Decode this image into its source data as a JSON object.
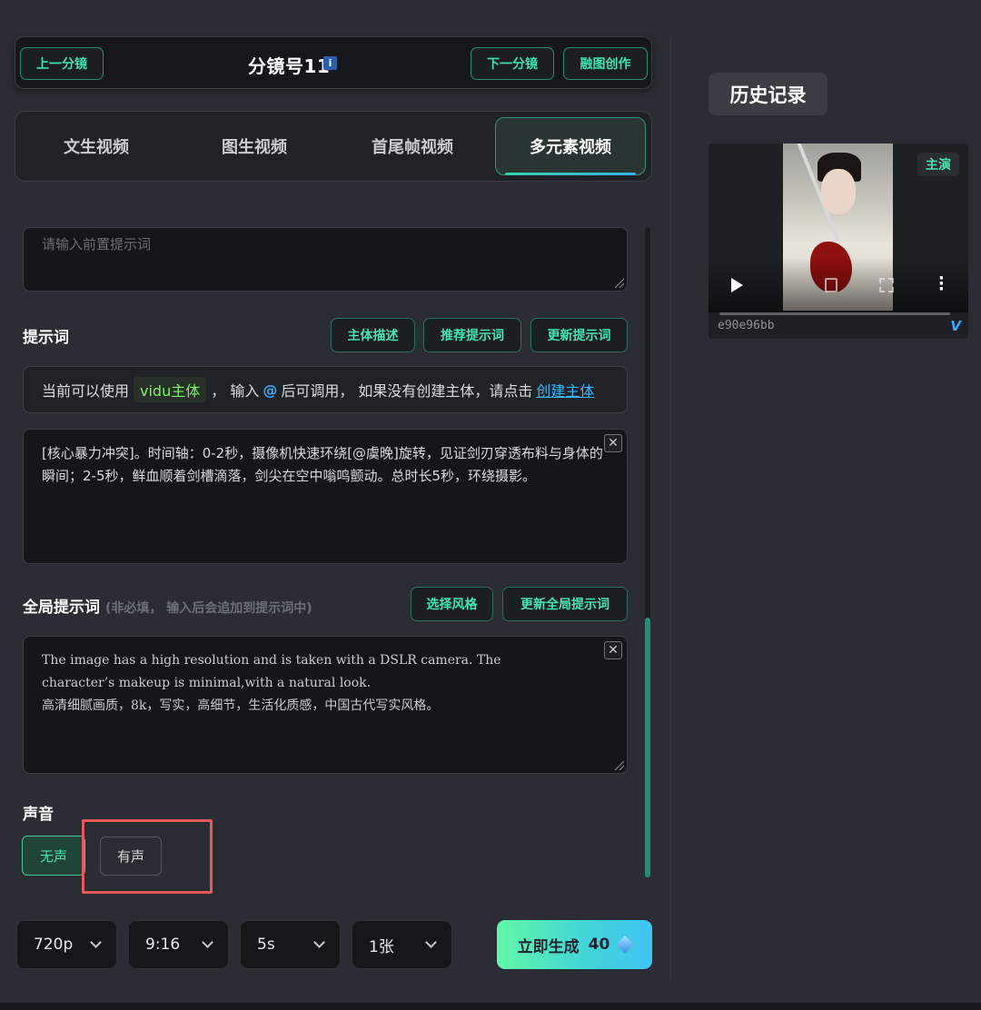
{
  "storyboard": {
    "prev_label": "上一分镜",
    "title": "分镜号11",
    "info_icon": "i",
    "next_label": "下一分镜",
    "blend_label": "融图创作"
  },
  "tabs": [
    {
      "label": "文生视频",
      "active": false
    },
    {
      "label": "图生视频",
      "active": false
    },
    {
      "label": "首尾帧视频",
      "active": false
    },
    {
      "label": "多元素视频",
      "active": true
    }
  ],
  "pre_prompt": {
    "placeholder": "请输入前置提示词"
  },
  "prompt": {
    "label": "提示词",
    "buttons": {
      "subject_desc": "主体描述",
      "recommend": "推荐提示词",
      "update": "更新提示词"
    },
    "notice": {
      "prefix": "当前可以使用",
      "chip": "vidu主体",
      "middle1": "，  输入",
      "at": "@",
      "middle2": "后可调用，  如果没有创建主体，请点击",
      "link": "创建主体"
    },
    "text": "[核心暴力冲突]。时间轴：0-2秒，摄像机快速环绕[@虞晚]旋转，见证剑刃穿透布料与身体的瞬间；2-5秒，鲜血顺着剑槽滴落，剑尖在空中嗡鸣颤动。总时长5秒，环绕摄影。"
  },
  "global_prompt": {
    "label": "全局提示词",
    "hint": "(非必填， 输入后会追加到提示词中)",
    "buttons": {
      "select_style": "选择风格",
      "update": "更新全局提示词"
    },
    "text_line1": "The image has a high resolution and is taken with a DSLR camera. The",
    "text_line2": "character’s makeup is minimal,with a natural look.",
    "text_line3": "高清细腻画质，8k，写实，高细节，生活化质感，中国古代写实风格。"
  },
  "sound": {
    "label": "声音",
    "off_label": "无声",
    "on_label": "有声",
    "selected": "无声"
  },
  "settings": {
    "resolution": "720p",
    "ratio": "9:16",
    "duration": "5s",
    "count": "1张"
  },
  "generate": {
    "label": "立即生成",
    "cost": "40"
  },
  "history": {
    "title": "历史记录",
    "items": [
      {
        "badge": "主演",
        "id": "e90e96bb",
        "progress": 0
      }
    ]
  },
  "colors": {
    "accent": "#3fe0ad",
    "link": "#38b6ff",
    "highlight": "#e65a5a"
  },
  "icons": [
    "info-icon",
    "close-icon",
    "chevron-down-icon",
    "gem-icon",
    "play-icon",
    "volume-icon",
    "fullscreen-icon",
    "more-icon",
    "vimeo-icon"
  ]
}
